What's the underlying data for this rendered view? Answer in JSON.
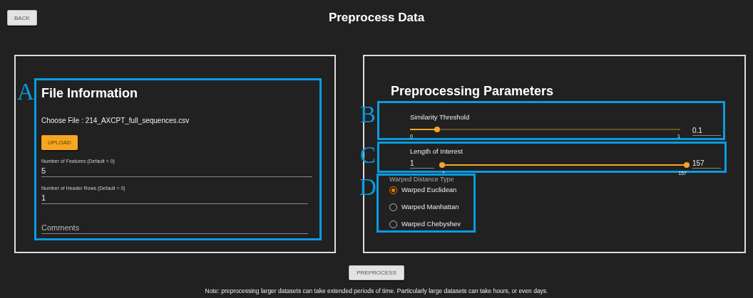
{
  "back_button": "BACK",
  "title": "Preprocess Data",
  "file_information": {
    "marker": "A",
    "title": "File Information",
    "choose_file": "Choose File : 214_AXCPT_full_sequences.csv",
    "upload_button": "UPLOAD",
    "fields": [
      {
        "label": "Number of Features (Default = 0)",
        "value": "5"
      },
      {
        "label": "Number of Header Rows (Default = 0)",
        "value": "1"
      },
      {
        "placeholder": "Comments"
      }
    ]
  },
  "preprocessing_parameters": {
    "title": "Preprocessing Parameters",
    "similarity_threshold": {
      "marker": "B",
      "label": "Similarity Threshold",
      "level": 0.1,
      "min_label": "0",
      "max_label": "1",
      "value": "0.1"
    },
    "length_of_interest": {
      "marker": "C",
      "label": "Length of Interest",
      "low_value": "1",
      "thumbs": [
        {
          "level": 0
        },
        {
          "level": 1
        }
      ],
      "min_label": "1",
      "max_label": "157",
      "high_value": "157"
    },
    "warped_distance_type": {
      "marker": "D",
      "label": "Warped Distance Type",
      "options": [
        {
          "label": "Warped Euclidean",
          "selected": true
        },
        {
          "label": "Warped Manhattan",
          "selected": false
        },
        {
          "label": "Warped Chebyshev",
          "selected": false
        }
      ]
    }
  },
  "preprocess_button": "PREPROCESS",
  "note": "Note: preprocessing larger datasets can take extended periods of time. Particularly large datasets can take hours, or even days."
}
